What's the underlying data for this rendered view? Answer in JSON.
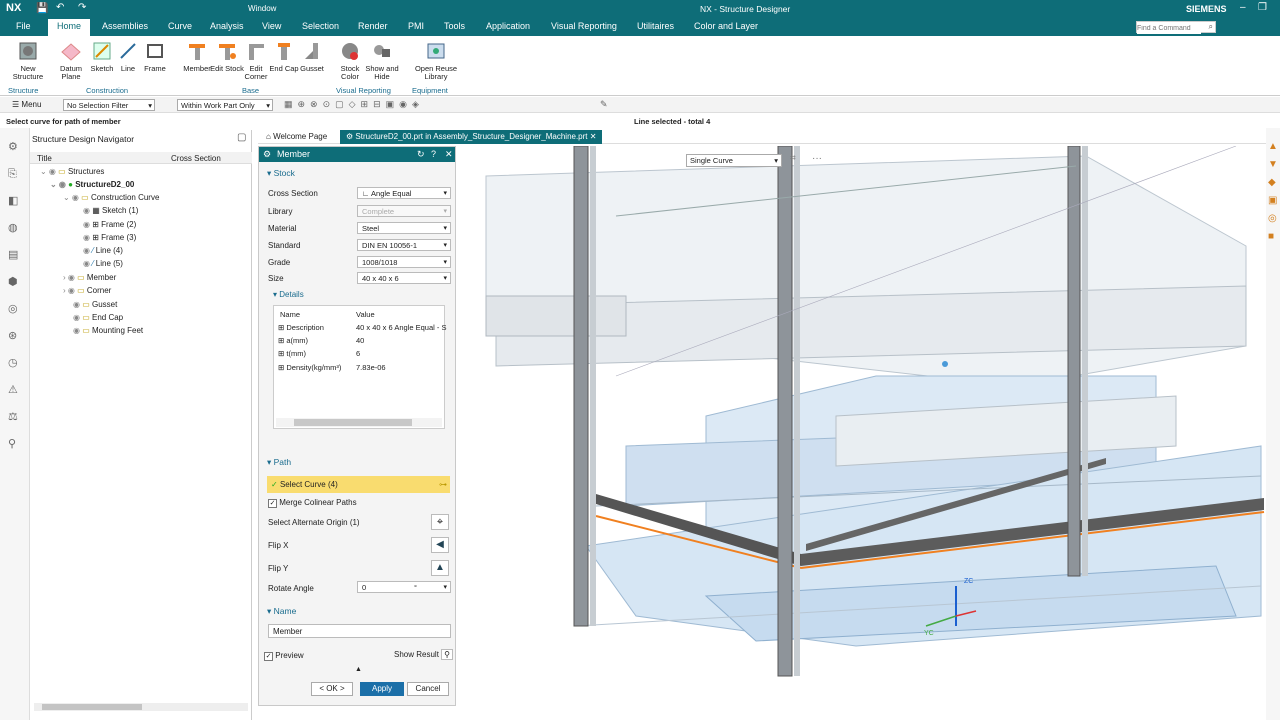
{
  "app": {
    "logo": "NX",
    "title": "NX - Structure Designer",
    "brand": "SIEMENS",
    "window_menu": "Window"
  },
  "menu": {
    "tabs": [
      "File",
      "Home",
      "Assemblies",
      "Curve",
      "Analysis",
      "View",
      "Selection",
      "Render",
      "PMI",
      "Tools",
      "Application",
      "Visual Reporting",
      "Utilitaires",
      "Color and Layer"
    ],
    "active": "Home",
    "search_placeholder": "Find a Command"
  },
  "ribbon": {
    "buttons": [
      {
        "label": "New Structure"
      },
      {
        "label": "Datum Plane"
      },
      {
        "label": "Sketch"
      },
      {
        "label": "Line"
      },
      {
        "label": "Frame"
      },
      {
        "label": "Member"
      },
      {
        "label": "Edit Stock"
      },
      {
        "label": "Edit Corner"
      },
      {
        "label": "End Cap"
      },
      {
        "label": "Gusset"
      },
      {
        "label": "Stock Color"
      },
      {
        "label": "Show and Hide"
      },
      {
        "label": "Open Reuse Library"
      }
    ],
    "groups": [
      "Structure",
      "Construction",
      "Base",
      "Visual Reporting",
      "Equipment"
    ]
  },
  "toolbar": {
    "menu_label": "Menu",
    "filter": "No Selection Filter",
    "scope": "Within Work Part Only"
  },
  "status": {
    "prompt": "Select curve for path of member",
    "selection": "Line selected - total 4"
  },
  "navigator": {
    "title": "Structure Design Navigator",
    "col_title": "Title",
    "col_cross": "Cross Section",
    "rows": [
      {
        "label": "Structures"
      },
      {
        "label": "StructureD2_00"
      },
      {
        "label": "Construction Curve"
      },
      {
        "label": "Sketch (1)"
      },
      {
        "label": "Frame (2)"
      },
      {
        "label": "Frame (3)"
      },
      {
        "label": "Line (4)"
      },
      {
        "label": "Line (5)"
      },
      {
        "label": "Member"
      },
      {
        "label": "Corner"
      },
      {
        "label": "Gusset"
      },
      {
        "label": "End Cap"
      },
      {
        "label": "Mounting Feet"
      }
    ]
  },
  "tabs": {
    "welcome": "Welcome Page",
    "file": "StructureD2_00.prt in Assembly_Structure_Designer_Machine.prt"
  },
  "dialog": {
    "title": "Member",
    "stock_section": "Stock",
    "cross_section_label": "Cross Section",
    "cross_section_value": "Angle Equal",
    "library_label": "Library",
    "library_value": "Complete",
    "material_label": "Material",
    "material_value": "Steel",
    "standard_label": "Standard",
    "standard_value": "DIN EN 10056-1",
    "grade_label": "Grade",
    "grade_value": "1008/1018",
    "size_label": "Size",
    "size_value": "40 x 40 x 6",
    "details_section": "Details",
    "details_col_name": "Name",
    "details_col_value": "Value",
    "details": [
      {
        "name": "Description",
        "value": "40 x 40 x 6 Angle Equal - S"
      },
      {
        "name": "a(mm)",
        "value": "40"
      },
      {
        "name": "t(mm)",
        "value": "6"
      },
      {
        "name": "Density(kg/mm³)",
        "value": "7.83e-06"
      }
    ],
    "path_section": "Path",
    "select_curve": "Select Curve (4)",
    "merge_colinear": "Merge Colinear Paths",
    "alternate_origin": "Select Alternate Origin (1)",
    "flip_x": "Flip X",
    "flip_y": "Flip Y",
    "rotate_angle_label": "Rotate Angle",
    "rotate_angle_value": "0",
    "rotate_unit": "°",
    "name_section": "Name",
    "name_value": "Member",
    "preview": "Preview",
    "show_result": "Show Result",
    "ok": "< OK >",
    "apply": "Apply",
    "cancel": "Cancel"
  },
  "viewport": {
    "curve_filter": "Single Curve",
    "axis_zc": "ZC",
    "axis_yc": "YC"
  }
}
